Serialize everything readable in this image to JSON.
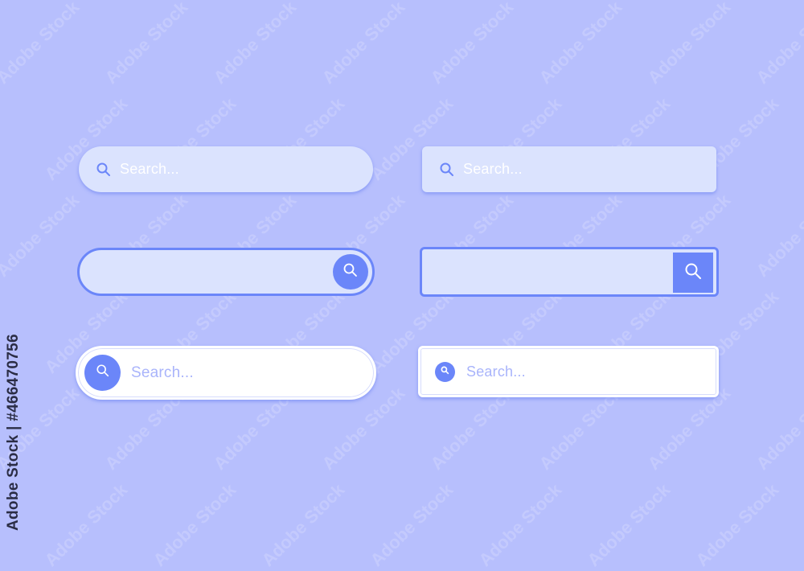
{
  "colors": {
    "background": "#b7bffd",
    "field_fill": "#dbe3fe",
    "accent": "#6b86f9",
    "placeholder_white": "#ffffff",
    "placeholder_lavender": "#a9b4fb"
  },
  "search_bars": [
    {
      "style": "pill-soft",
      "placeholder": "Search...",
      "icon": "search-icon",
      "icon_position": "left"
    },
    {
      "style": "rect-soft",
      "placeholder": "Search...",
      "icon": "search-icon",
      "icon_position": "left"
    },
    {
      "style": "pill-outlined",
      "placeholder": "",
      "icon": "search-icon",
      "icon_position": "right-button"
    },
    {
      "style": "rect-outlined",
      "placeholder": "",
      "icon": "search-icon",
      "icon_position": "right-button"
    },
    {
      "style": "pill-white",
      "placeholder": "Search...",
      "icon": "search-icon",
      "icon_position": "left-button"
    },
    {
      "style": "rect-white",
      "placeholder": "Search...",
      "icon": "search-icon",
      "icon_position": "left-button"
    }
  ],
  "watermark": {
    "vertical_text": "Adobe Stock | #466470756",
    "diagonal_text": "Adobe Stock"
  }
}
